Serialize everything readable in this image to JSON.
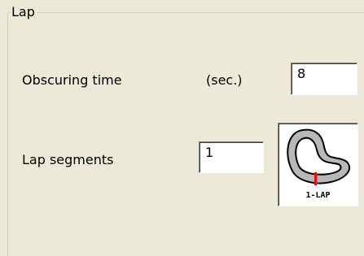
{
  "group": {
    "title": "Lap"
  },
  "obscuring": {
    "label": "Obscuring time",
    "unit": "(sec.)",
    "value": "8"
  },
  "segments": {
    "label": "Lap segments",
    "value": "1"
  },
  "preview": {
    "icon": "lap-track-icon",
    "caption": "1-LAP",
    "colors": {
      "track_outline": "#000000",
      "track_fill": "#b8b8b8",
      "marker": "#e01010"
    }
  }
}
